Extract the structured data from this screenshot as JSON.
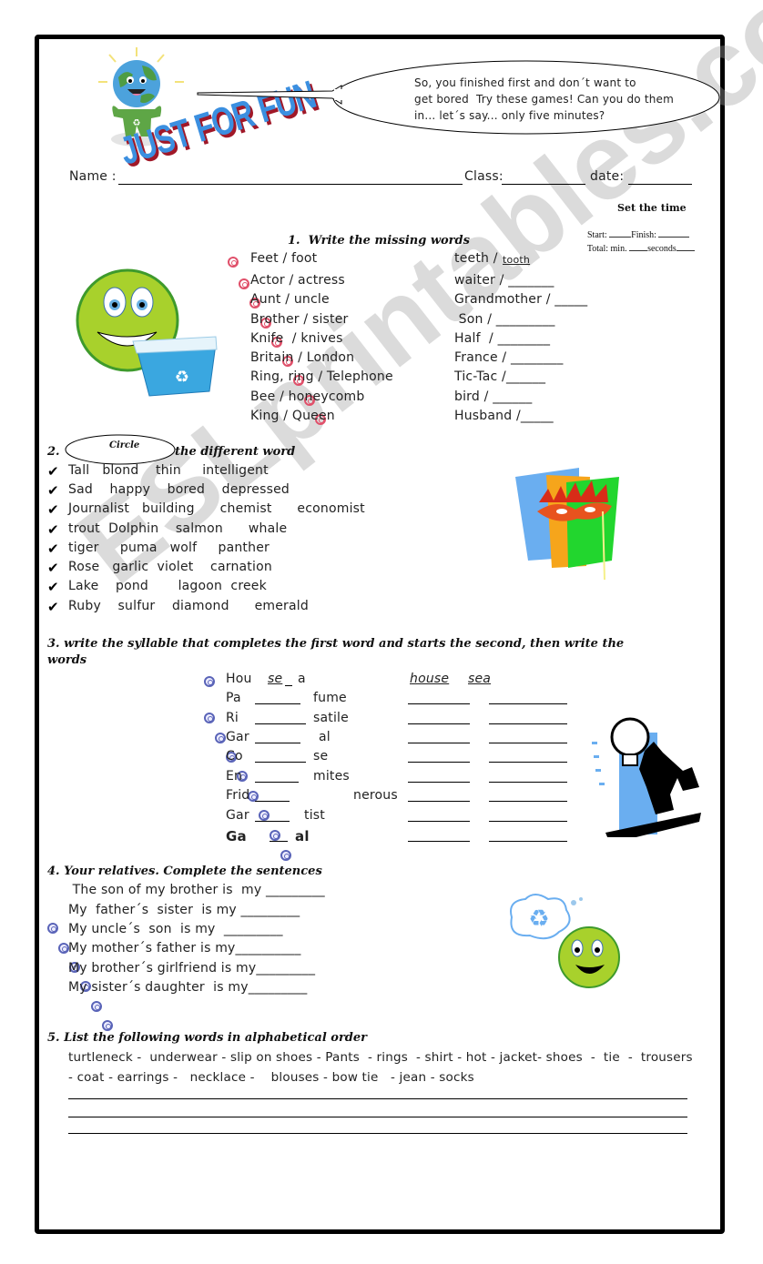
{
  "header": {
    "title_art": "JUST FOR FUN",
    "speech_bubble": [
      "So, you finished first and don´t want to",
      "get bored  Try these games! Can you do them",
      "in... let´s say... only five minutes?"
    ],
    "name_label": "Name :",
    "class_label": "Class:",
    "date_label": "date:"
  },
  "timer": {
    "title": "Set the time",
    "start_label": "Start:",
    "finish_label": "Finish:",
    "total_label": "Total: min.",
    "seconds_label": "seconds"
  },
  "section1": {
    "title": "1.  Write the missing words",
    "rows": [
      {
        "left": "Feet / foot",
        "right": "teeth /",
        "answer": "tooth"
      },
      {
        "left": "Actor / actress",
        "right": "waiter / _______"
      },
      {
        "left": "Aunt / uncle",
        "right": "Grandmother / _____"
      },
      {
        "left": "Brother / sister",
        "right": " Son / _________"
      },
      {
        "left": "Knife  / knives",
        "right": "Half  / ________"
      },
      {
        "left": "Britain / London",
        "right": "France / ________"
      },
      {
        "left": "Ring, ring / Telephone",
        "right": "Tic-Tac /______"
      },
      {
        "left": "Bee / honeycomb",
        "right": "bird / ______"
      },
      {
        "left": "King / Queen",
        "right": "Husband /_____"
      }
    ]
  },
  "section2": {
    "number": "2.",
    "circle_word": "Circle",
    "title": "the different word",
    "rows": [
      "Tall   blond    thin     intelligent",
      "Sad    happy    bored    depressed",
      "Journalist   building      chemist      economist",
      "trout  Dolphin    salmon      whale",
      "tiger     puma   wolf     panther",
      "Rose   garlic  violet    carnation",
      "Lake    pond       lagoon  creek",
      "Ruby    sulfur    diamond      emerald"
    ]
  },
  "section3": {
    "title_line1": "3. write the syllable that completes the first word and starts the second, then write the",
    "title_line2": "words",
    "example": {
      "first": "Hou",
      "syllable": "se",
      "second": "a",
      "answer1": "house",
      "answer2": "sea"
    },
    "rows": [
      {
        "first": "Pa",
        "second": "fume"
      },
      {
        "first": "Ri",
        "second": "satile"
      },
      {
        "first": "Gar",
        "second": "al"
      },
      {
        "first": "Co",
        "second": "se"
      },
      {
        "first": "En",
        "second": "mites"
      },
      {
        "first": "Frid",
        "second": "nerous"
      },
      {
        "first": "Gar",
        "second": "tist"
      },
      {
        "first": "Ga",
        "second": "al"
      }
    ]
  },
  "section4": {
    "title": "4. Your relatives. Complete the sentences",
    "rows": [
      " The son of my brother is  my _________",
      "My  father´s  sister  is my _________",
      "My uncle´s  son  is my  _________",
      "My mother´s father is my__________",
      "My brother´s girlfriend is my_________",
      "My sister´s daughter  is my_________"
    ]
  },
  "section5": {
    "title": "5. List the following words in alphabetical order",
    "line1": "turtleneck -  underwear - slip on shoes - Pants  - rings  - shirt - hot - jacket- shoes  -  tie  -  trousers",
    "line2": "- coat - earrings -   necklace -    blouses - bow tie   - jean - socks"
  },
  "watermark": "ESLprintables.com"
}
